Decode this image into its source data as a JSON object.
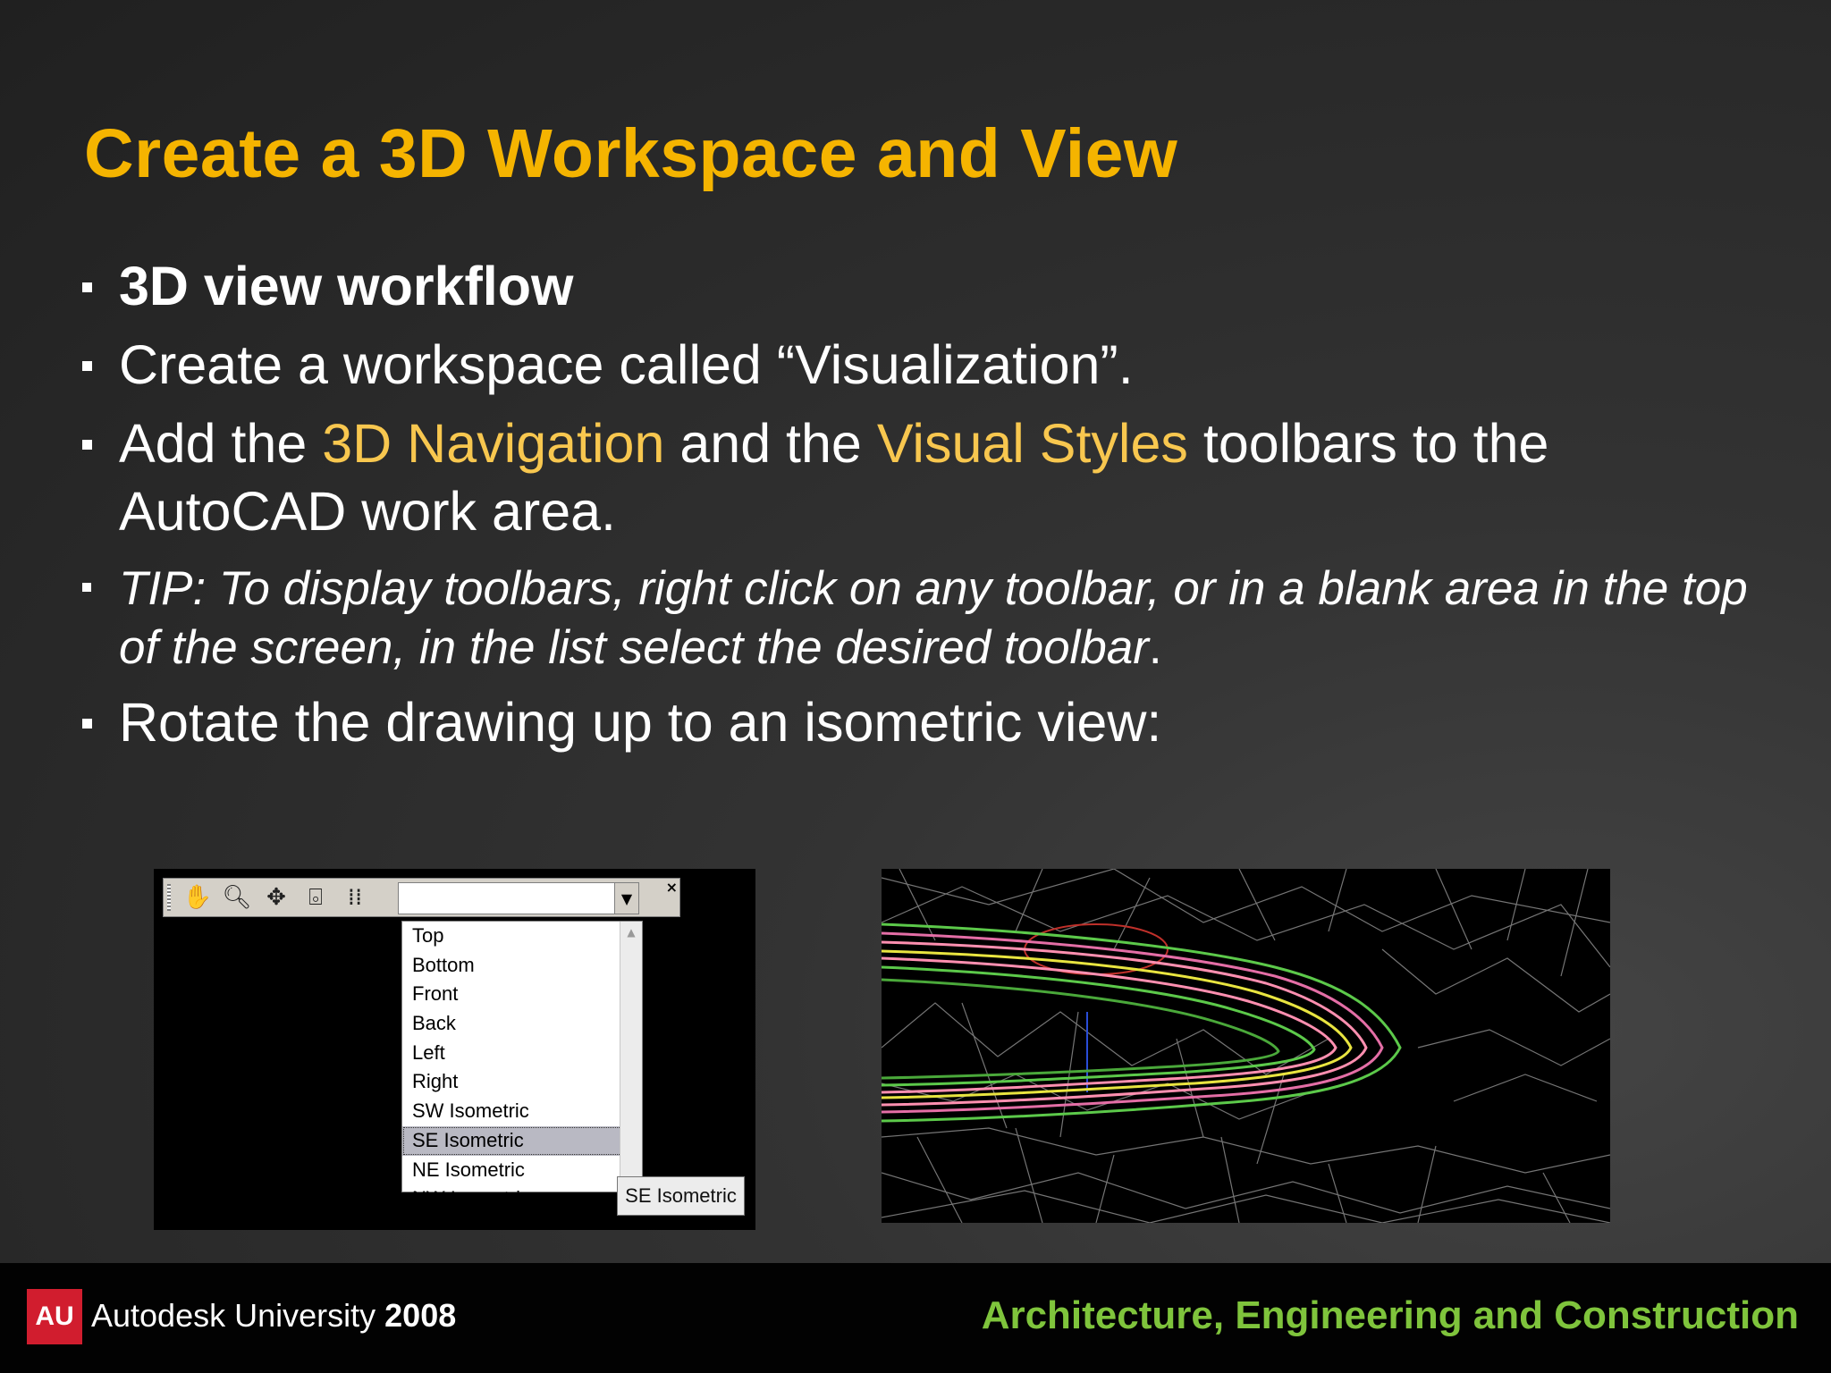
{
  "title": "Create a 3D Workspace and View",
  "bullets": {
    "b1": "3D view workflow",
    "b2": "Create a workspace called  “Visualization”.",
    "b3_pre": "Add the ",
    "b3_hl1": "3D Navigation",
    "b3_mid": " and the ",
    "b3_hl2": "Visual Styles",
    "b3_post": " toolbars to the AutoCAD work area.",
    "tip_italic": "TIP:  To display toolbars, right click on any toolbar, or in a blank area in the top of the screen, in the list select the desired toolbar",
    "tip_end": ".",
    "b5": "Rotate the drawing up to an isometric view:"
  },
  "toolbar_screenshot": {
    "icons": [
      "pan-icon",
      "zoom-icon",
      "orbit-icon",
      "camera-icon",
      "walk-icon"
    ],
    "combo_value": "",
    "dropdown_items": [
      "Top",
      "Bottom",
      "Front",
      "Back",
      "Left",
      "Right",
      "SW Isometric",
      "SE Isometric",
      "NE Isometric",
      "NW Isometric"
    ],
    "selected_item": "SE Isometric",
    "tooltip": "SE Isometric"
  },
  "footer": {
    "logo_text": "AU",
    "brand": "Autodesk University",
    "year": "2008",
    "track": "Architecture, Engineering and Construction"
  },
  "colors": {
    "title": "#f5b400",
    "highlight": "#f8c74f",
    "footer_track": "#7fc43c",
    "au_red": "#d11d2e"
  }
}
